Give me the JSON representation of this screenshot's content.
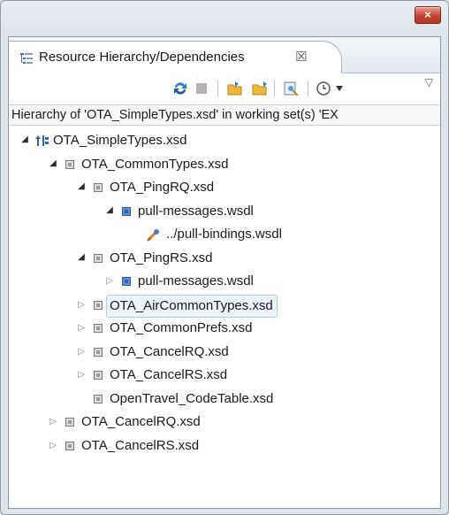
{
  "window": {
    "close_label": "×"
  },
  "tab": {
    "title": "Resource Hierarchy/Dependencies",
    "close_label": "☒"
  },
  "toolbar": {
    "view_menu_label": "▽"
  },
  "status": {
    "text": "Hierarchy of 'OTA_SimpleTypes.xsd' in working set(s) 'EX"
  },
  "tree": {
    "items": [
      {
        "label": "OTA_SimpleTypes.xsd",
        "depth": 0,
        "expanded": true,
        "icon": "hierarchy-root-icon"
      },
      {
        "label": "OTA_CommonTypes.xsd",
        "depth": 1,
        "expanded": true,
        "icon": "xsd-file-icon"
      },
      {
        "label": "OTA_PingRQ.xsd",
        "depth": 2,
        "expanded": true,
        "icon": "xsd-file-icon"
      },
      {
        "label": "pull-messages.wsdl",
        "depth": 3,
        "expanded": true,
        "icon": "wsdl-file-icon"
      },
      {
        "label": "../pull-bindings.wsdl",
        "depth": 4,
        "expanded": null,
        "icon": "cycle-link-icon"
      },
      {
        "label": "OTA_PingRS.xsd",
        "depth": 2,
        "expanded": true,
        "icon": "xsd-file-icon"
      },
      {
        "label": "pull-messages.wsdl",
        "depth": 3,
        "expanded": false,
        "icon": "wsdl-file-icon"
      },
      {
        "label": "OTA_AirCommonTypes.xsd",
        "depth": 2,
        "expanded": false,
        "icon": "xsd-file-icon",
        "selected": true
      },
      {
        "label": "OTA_CommonPrefs.xsd",
        "depth": 2,
        "expanded": false,
        "icon": "xsd-file-icon"
      },
      {
        "label": "OTA_CancelRQ.xsd",
        "depth": 2,
        "expanded": false,
        "icon": "xsd-file-icon"
      },
      {
        "label": "OTA_CancelRS.xsd",
        "depth": 2,
        "expanded": false,
        "icon": "xsd-file-icon"
      },
      {
        "label": "OpenTravel_CodeTable.xsd",
        "depth": 2,
        "expanded": null,
        "icon": "xsd-file-icon"
      },
      {
        "label": "OTA_CancelRQ.xsd",
        "depth": 1,
        "expanded": false,
        "icon": "xsd-file-icon"
      },
      {
        "label": "OTA_CancelRS.xsd",
        "depth": 1,
        "expanded": false,
        "icon": "xsd-file-icon"
      }
    ]
  },
  "colors": {
    "selection_bg": "#ebf4fd",
    "selection_border": "#a8cdf0",
    "wsdl_icon": "#5b8fd6",
    "xsd_icon": "#dcdcdc"
  }
}
